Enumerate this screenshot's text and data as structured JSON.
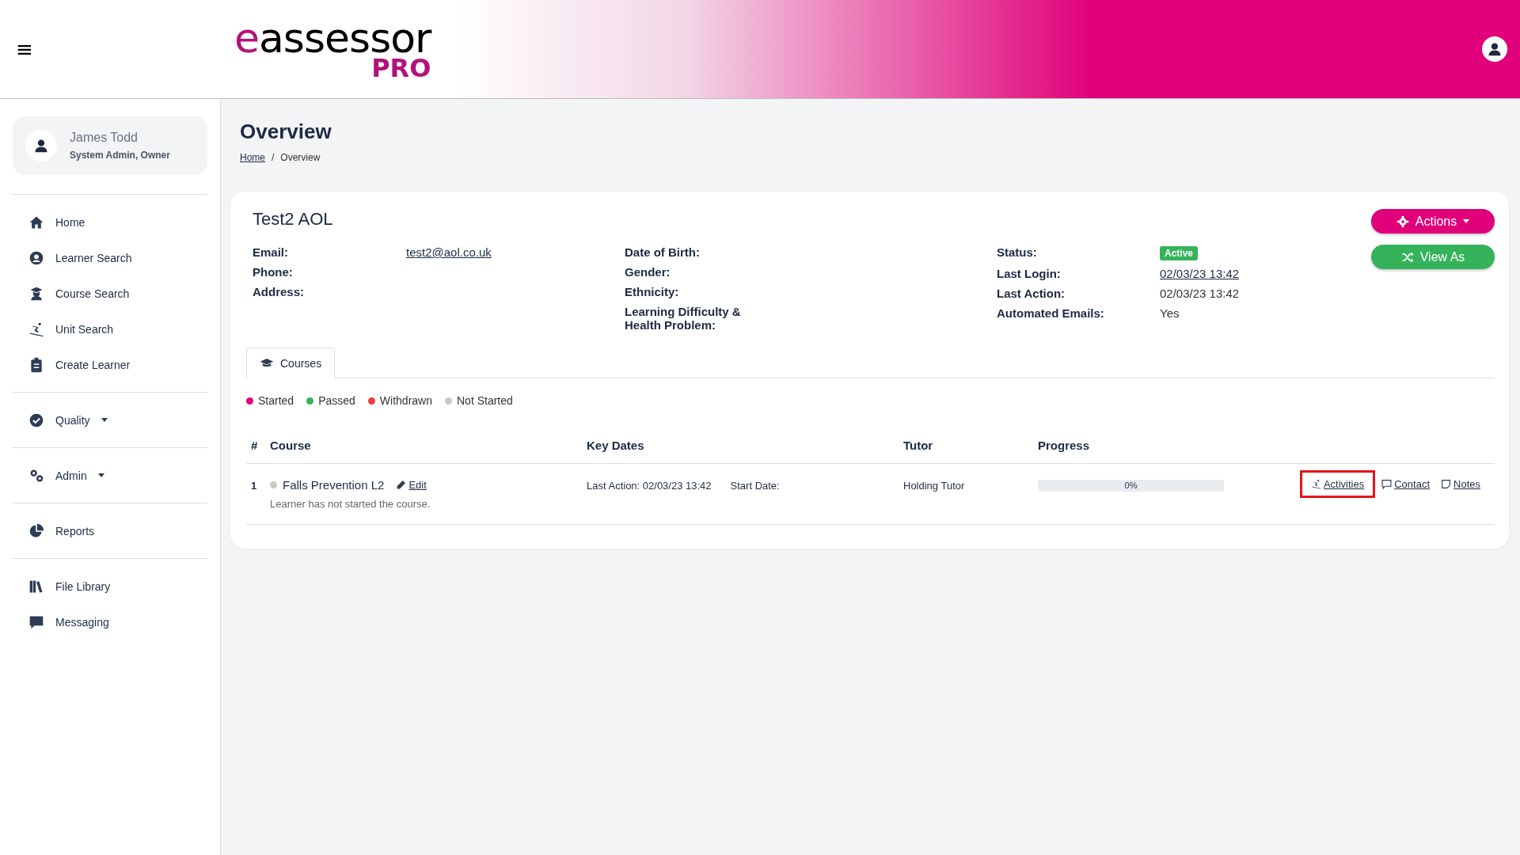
{
  "header": {
    "menu_glyph": "≡",
    "logo": {
      "name": "eassessor",
      "tag": "PRO"
    }
  },
  "sidebar": {
    "user": {
      "name": "James Todd",
      "role": "System Admin, Owner"
    },
    "groups": [
      [
        {
          "label": "Home"
        },
        {
          "label": "Learner Search"
        },
        {
          "label": "Course Search"
        },
        {
          "label": "Unit Search"
        },
        {
          "label": "Create Learner"
        }
      ],
      [
        {
          "label": "Quality",
          "dropdown": true
        }
      ],
      [
        {
          "label": "Admin",
          "dropdown": true
        }
      ],
      [
        {
          "label": "Reports"
        }
      ],
      [
        {
          "label": "File Library"
        },
        {
          "label": "Messaging"
        }
      ]
    ]
  },
  "page": {
    "title": "Overview",
    "separator": "/",
    "breadcrumb": [
      {
        "label": "Home",
        "link": true
      },
      {
        "label": "Overview",
        "link": false
      }
    ]
  },
  "learner": {
    "name": "Test2 AOL",
    "buttons": [
      {
        "label": "Actions",
        "kind": "primary",
        "dropdown": true
      },
      {
        "label": "View As",
        "kind": "success",
        "dropdown": false
      }
    ],
    "details": [
      [
        {
          "label": "Email:",
          "value": "test2@aol.co.uk",
          "kind": "link"
        },
        {
          "label": "Phone:"
        },
        {
          "label": "Address:"
        }
      ],
      [
        {
          "label": "Date of Birth:"
        },
        {
          "label": "Gender:"
        },
        {
          "label": "Ethnicity:"
        },
        {
          "label": "Learning Difficulty & Health Problem:"
        }
      ],
      [
        {
          "label": "Status:",
          "value": "Active",
          "kind": "badge"
        },
        {
          "label": "Last Login:",
          "value": "02/03/23 13:42",
          "kind": "link"
        },
        {
          "label": "Last Action:",
          "value": "02/03/23 13:42",
          "kind": "text"
        },
        {
          "label": "Automated Emails:",
          "value": "Yes",
          "kind": "text"
        }
      ]
    ]
  },
  "tabs": [
    {
      "label": "Courses",
      "selected": true
    }
  ],
  "legend": [
    {
      "label": "Started",
      "color": "#e0007a"
    },
    {
      "label": "Passed",
      "color": "#34b35a"
    },
    {
      "label": "Withdrawn",
      "color": "#f03c3c"
    },
    {
      "label": "Not Started",
      "color": "#c8c8c8"
    }
  ],
  "table": {
    "columns": [
      "#",
      "Course",
      "Key Dates",
      "Tutor",
      "Progress"
    ],
    "rows": [
      {
        "number": "1",
        "course": "Falls Prevention L2",
        "color": "#c8c8c8",
        "edit": "Edit",
        "note": "Learner has not started the course.",
        "key_dates": [
          "Last Action: 02/03/23 13:42",
          "Start Date:"
        ],
        "tutor": "Holding Tutor",
        "progress": {
          "level": 0,
          "reading": "0%"
        },
        "actions": [
          {
            "label": "Activities",
            "highlighted": true
          },
          {
            "label": "Contact",
            "highlighted": false
          },
          {
            "label": "Notes",
            "highlighted": false
          }
        ]
      }
    ]
  }
}
